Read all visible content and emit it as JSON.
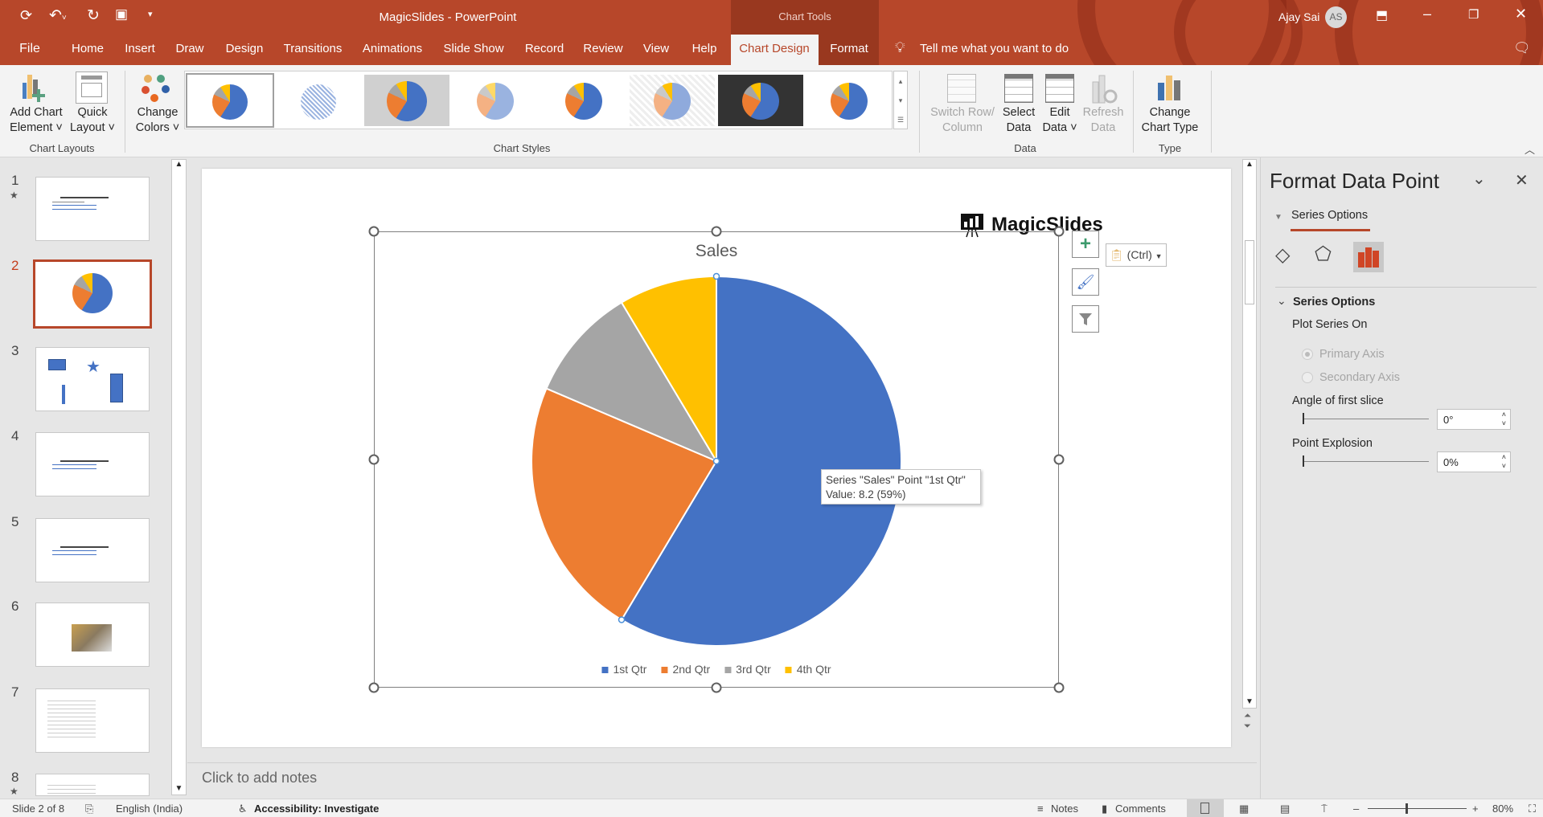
{
  "titlebar": {
    "title": "MagicSlides  -  PowerPoint",
    "context_tab_group": "Chart Tools",
    "user_name": "Ajay Sai",
    "user_initials": "AS",
    "quick_access": [
      "save-icon",
      "undo-icon",
      "redo-icon",
      "start-from-beginning-icon",
      "customize-icon"
    ]
  },
  "tabs": [
    "File",
    "Home",
    "Insert",
    "Draw",
    "Design",
    "Transitions",
    "Animations",
    "Slide Show",
    "Record",
    "Review",
    "View",
    "Help",
    "Chart Design",
    "Format"
  ],
  "active_tab": "Chart Design",
  "tell_me": "Tell me what you want to do",
  "ribbon": {
    "add_chart_element": [
      "Add Chart",
      "Element ˅"
    ],
    "quick_layout": [
      "Quick",
      "Layout ˅"
    ],
    "change_colors": [
      "Change",
      "Colors ˅"
    ],
    "chart_layouts_label": "Chart Layouts",
    "chart_styles_label": "Chart Styles",
    "switch_row_column": [
      "Switch Row/",
      "Column"
    ],
    "select_data": [
      "Select",
      "Data"
    ],
    "edit_data": [
      "Edit",
      "Data ˅"
    ],
    "refresh_data": [
      "Refresh",
      "Data"
    ],
    "data_label": "Data",
    "change_chart_type": [
      "Change",
      "Chart Type"
    ],
    "type_label": "Type"
  },
  "slides": [
    {
      "num": "1",
      "starred": true
    },
    {
      "num": "2",
      "active": true
    },
    {
      "num": "3"
    },
    {
      "num": "4"
    },
    {
      "num": "5"
    },
    {
      "num": "6"
    },
    {
      "num": "7"
    },
    {
      "num": "8",
      "starred": true
    }
  ],
  "slide": {
    "logo_text": "MagicSlides",
    "paste_options": "(Ctrl)",
    "tooltip_line1": "Series \"Sales\" Point \"1st Qtr\"",
    "tooltip_line2": "Value: 8.2 (59%)"
  },
  "chart_data": {
    "type": "pie",
    "title": "Sales",
    "categories": [
      "1st Qtr",
      "2nd Qtr",
      "3rd Qtr",
      "4th Qtr"
    ],
    "values": [
      8.2,
      3.2,
      1.4,
      1.2
    ],
    "colors": [
      "#4472c4",
      "#ed7d31",
      "#a5a5a5",
      "#ffc000"
    ],
    "legend_position": "bottom",
    "selected_point": "1st Qtr"
  },
  "notes_placeholder": "Click to add notes",
  "format_pane": {
    "title": "Format Data Point",
    "section_tab": "Series Options",
    "section_header": "Series Options",
    "plot_series_on": "Plot Series On",
    "primary_axis": "Primary Axis",
    "secondary_axis": "Secondary Axis",
    "angle_label": "Angle of first slice",
    "angle_value": "0°",
    "explosion_label": "Point Explosion",
    "explosion_value": "0%",
    "angle_degrees": 0,
    "explosion_percent": 0
  },
  "statusbar": {
    "slide_info": "Slide 2 of 8",
    "language": "English (India)",
    "accessibility": "Accessibility: Investigate",
    "notes": "Notes",
    "comments": "Comments",
    "zoom": "80%",
    "zoom_percent": 80
  },
  "colors": {
    "accent": "#b7472a",
    "context_tab": "#99381f"
  }
}
